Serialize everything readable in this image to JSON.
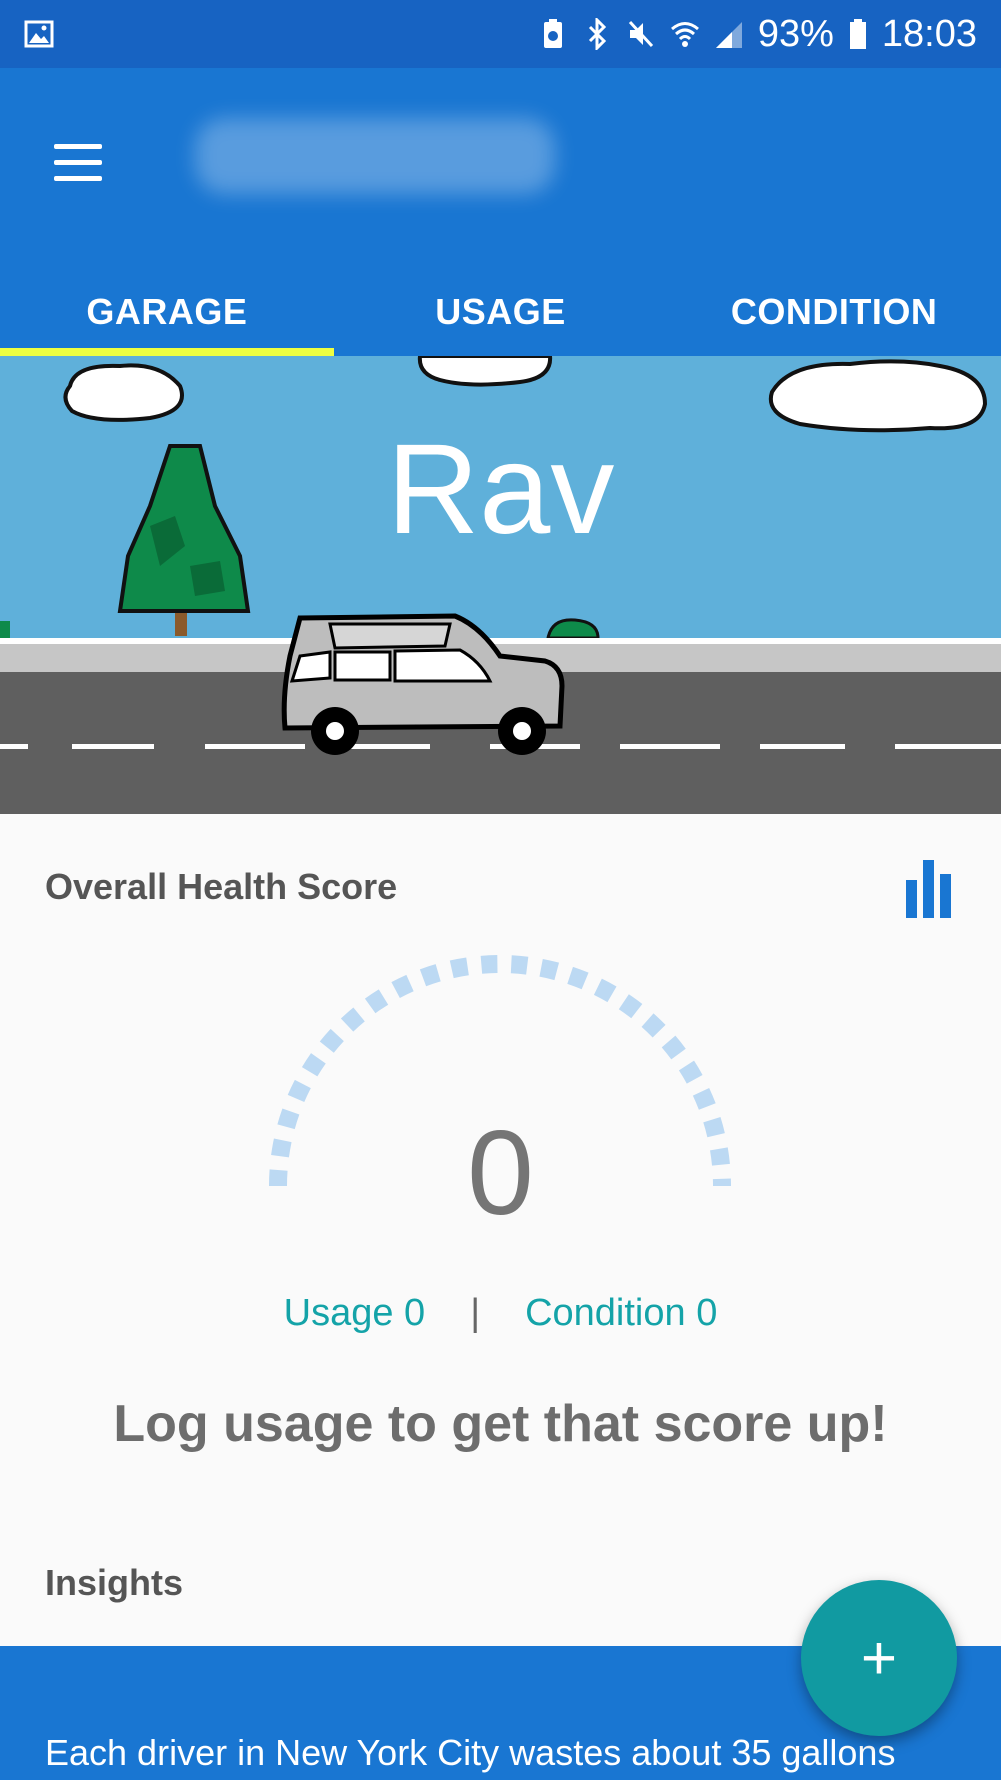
{
  "status_bar": {
    "battery_percent": "93%",
    "time": "18:03",
    "icons": [
      "image-icon",
      "battery-saver-icon",
      "bluetooth-icon",
      "mute-icon",
      "wifi-icon",
      "signal-icon",
      "battery-icon"
    ]
  },
  "app_bar": {
    "title": "",
    "menu_icon": "menu-icon",
    "tabs": [
      {
        "label": "GARAGE",
        "active": true
      },
      {
        "label": "USAGE",
        "active": false
      },
      {
        "label": "CONDITION",
        "active": false
      }
    ]
  },
  "hero": {
    "vehicle_name": "Rav"
  },
  "health": {
    "section_title": "Overall Health Score",
    "stats_icon": "bar-chart-icon",
    "score": "0",
    "usage_label": "Usage 0",
    "condition_label": "Condition 0",
    "separator": "|",
    "motivation": "Log usage to get that score up!"
  },
  "insights": {
    "section_title": "Insights",
    "card_text": "Each driver in New York City wastes about 35 gallons"
  },
  "fab": {
    "label": "+"
  },
  "colors": {
    "status_bar": "#1763c2",
    "primary": "#1976d2",
    "tab_indicator": "#eeff41",
    "sky": "#5fb0da",
    "accent_teal": "#119aa1",
    "gauge_dots": "#bcd9f3"
  }
}
